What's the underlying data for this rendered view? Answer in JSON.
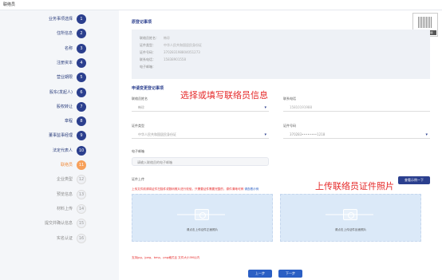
{
  "header": {
    "title": "联络员"
  },
  "steps": [
    {
      "num": "1",
      "label": "业务事项选择",
      "state": "done"
    },
    {
      "num": "2",
      "label": "住所信息",
      "state": "done"
    },
    {
      "num": "3",
      "label": "名称",
      "state": "done"
    },
    {
      "num": "4",
      "label": "注册资本",
      "state": "done"
    },
    {
      "num": "5",
      "label": "营业期限",
      "state": "done"
    },
    {
      "num": "6",
      "label": "股东(发起人)",
      "state": "done"
    },
    {
      "num": "7",
      "label": "股权转让",
      "state": "done"
    },
    {
      "num": "8",
      "label": "章程",
      "state": "done"
    },
    {
      "num": "9",
      "label": "董事监事经理",
      "state": "done"
    },
    {
      "num": "10",
      "label": "法定代表人",
      "state": "done"
    },
    {
      "num": "11",
      "label": "联络员",
      "state": "current"
    },
    {
      "num": "12",
      "label": "企业类型",
      "state": "todo"
    },
    {
      "num": "13",
      "label": "预览信息",
      "state": "todo"
    },
    {
      "num": "14",
      "label": "材料上传",
      "state": "todo"
    },
    {
      "num": "15",
      "label": "提交并确认信息",
      "state": "todo"
    },
    {
      "num": "16",
      "label": "实名认证",
      "state": "todo"
    }
  ],
  "original": {
    "title": "原登记事项",
    "rows": [
      {
        "key": "联络员姓名：",
        "value": "韩珍"
      },
      {
        "key": "证件类型：",
        "value": "中华人民共和国居民身份证"
      },
      {
        "key": "证件号码：",
        "value": "370283198804051273"
      },
      {
        "key": "联系电话：",
        "value": "15838901558"
      },
      {
        "key": "电子邮箱：",
        "value": ""
      }
    ]
  },
  "qr": {
    "caption": "扫码联系客服"
  },
  "change": {
    "title": "申请变更登记事项",
    "name_label": "联络员姓名",
    "name_value": "韩珍",
    "phone_label": "联系电话",
    "phone_value": "15810191988",
    "idtype_label": "证件类型",
    "idtype_value": "中华人民共和国居民身份证",
    "idno_label": "证件号码",
    "idno_value": "370283••••••••1218",
    "email_label": "电子邮箱",
    "email_placeholder": "请输入联络员的电子邮箱"
  },
  "annotations": {
    "fill_info": "选择或填写联络员信息",
    "upload_photo": "上传联络员证件照片"
  },
  "upload": {
    "title": "证件上传",
    "hint": "上传文件前请将证件扫描件或数码照片进行校验，只需要证件需要完整的，原件清晰可辨",
    "hint_link": "请查看示例",
    "guide_button": "查看示例一下",
    "front_caption": "请点击上传证件正面照片",
    "back_caption": "请点击上传证件反面照片",
    "format_note": "支持jpg、jpeg、bmp、png格式且 文件大小5M以内"
  },
  "footer": {
    "prev": "上一步",
    "next": "下一步"
  }
}
